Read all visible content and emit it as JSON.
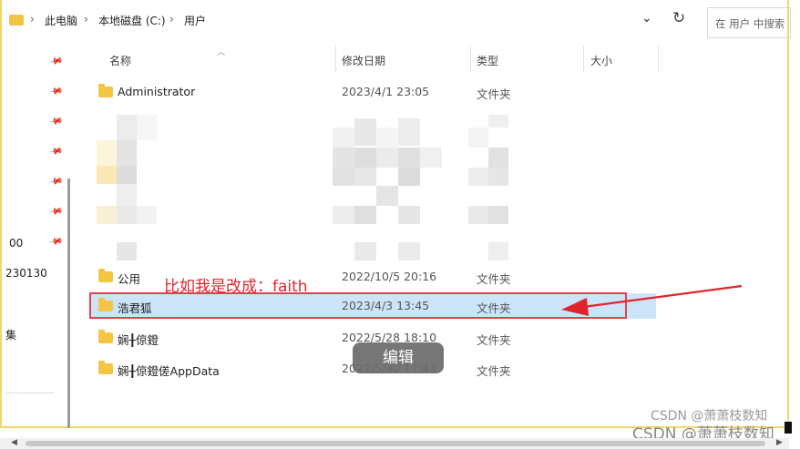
{
  "address": {
    "crumbs": [
      "此电脑",
      "本地磁盘 (C:)",
      "用户"
    ],
    "separator": "›"
  },
  "toolbar": {
    "dropdown_icon": "chevron-down",
    "refresh_icon": "refresh",
    "refresh_glyph": "↻",
    "dropdown_glyph": "⌄"
  },
  "search": {
    "placeholder": "在 用户 中搜索"
  },
  "nav": {
    "items": [
      "00",
      "230130",
      "集"
    ]
  },
  "columns": {
    "name": "名称",
    "date": "修改日期",
    "type": "类型",
    "size": "大小"
  },
  "rows": [
    {
      "name": "Administrator",
      "date": "2023/4/1 23:05",
      "type": "文件夹"
    },
    {
      "name": "公用",
      "date": "2022/10/5 20:16",
      "type": "文件夹"
    },
    {
      "name": "浩君狐",
      "date": "2023/4/3 13:45",
      "type": "文件夹"
    },
    {
      "name": "娴╂倞鐙",
      "date": "2022/5/28 18:10",
      "type": "文件夹"
    },
    {
      "name": "娴╂倞鐙傞AppData",
      "date": "2022/5/30 17:43",
      "type": "文件夹"
    }
  ],
  "annotation": {
    "text": "比如我是改成：faith",
    "color": "#e0242c"
  },
  "tooltip": {
    "text": "编辑"
  },
  "watermark": {
    "line1": "CSDN @萧萧枝数知",
    "line2": "CSDN @萧萧枝数知"
  },
  "colors": {
    "folder": "#f4c542",
    "selection": "#cce4f7",
    "highlight_border": "#e0424a",
    "frame": "#f5d66b"
  }
}
